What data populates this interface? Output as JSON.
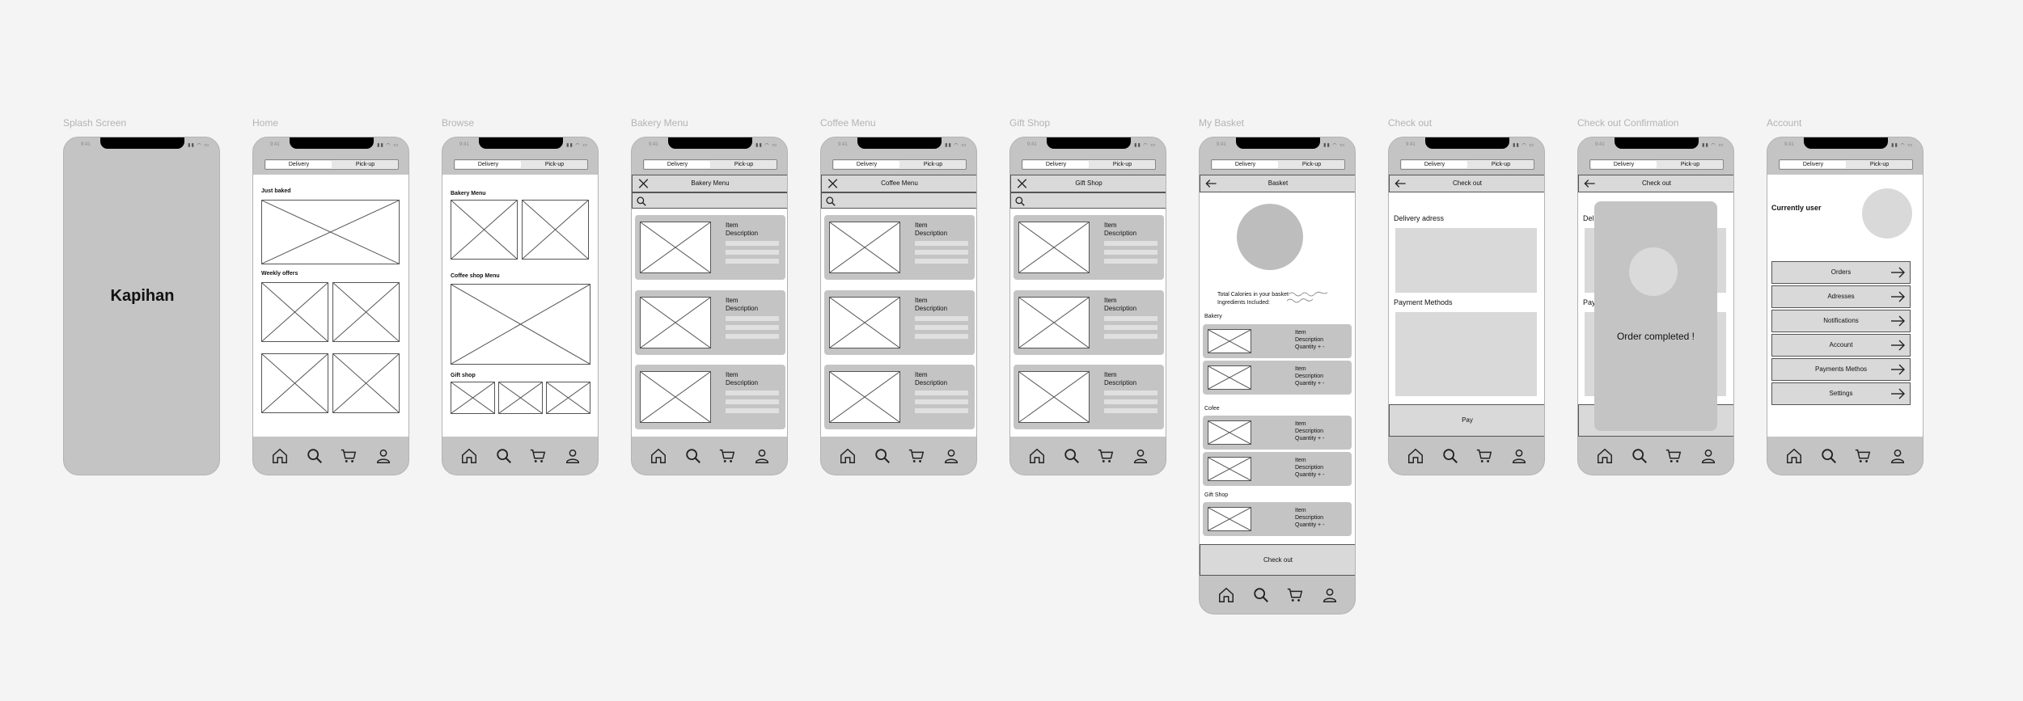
{
  "status_time": "9:41",
  "tabs": {
    "delivery": "Delivery",
    "pickup": "Pick-up"
  },
  "frames": {
    "splash": {
      "label": "Splash Screen",
      "brand": "Kapihan"
    },
    "home": {
      "label": "Home",
      "just_baked": "Just baked",
      "weekly_offers": "Weekly offers"
    },
    "browse": {
      "label": "Browse",
      "bakery_menu": "Bakery Menu",
      "coffee_menu": "Coffee shop Menu",
      "gift_shop": "Gift shop"
    },
    "bakery": {
      "label": "Bakery Menu",
      "header": "Bakery Menu"
    },
    "coffee": {
      "label": "Coffee Menu",
      "header": "Coffee Menu"
    },
    "gift": {
      "label": "Gift Shop",
      "header": "Gift Shop"
    },
    "basket": {
      "label": "My Basket",
      "header": "Basket",
      "calories": "Total Calories in your basket",
      "ingredients": "Ingredients Included:",
      "sec_bakery": "Bakery",
      "sec_coffee": "Cofee",
      "sec_gift": "Gift Shop",
      "checkout_btn": "Check out"
    },
    "checkout": {
      "label": "Check out",
      "header": "Check out",
      "delivery_address": "Delivery adress",
      "payment_methods": "Payment Methods",
      "pay": "Pay"
    },
    "confirm": {
      "label": "Check out Confirmation",
      "header": "Check out",
      "peek_1": "Deli",
      "peek_2": "Pay",
      "completed": "Order completed !"
    },
    "account": {
      "label": "Account",
      "current_user": "Currently user",
      "menu": [
        "Orders",
        "Adresses",
        "Notifications",
        "Account",
        "Payments Methos",
        "Settings"
      ]
    }
  },
  "item": {
    "title": "Item",
    "desc": "Description",
    "qty": "Quantity + -"
  },
  "colors": {
    "bg": "#f4f4f4",
    "phone": "#c4c4c4",
    "panel": "#d9d9d9",
    "card": "#c4c4c4"
  }
}
